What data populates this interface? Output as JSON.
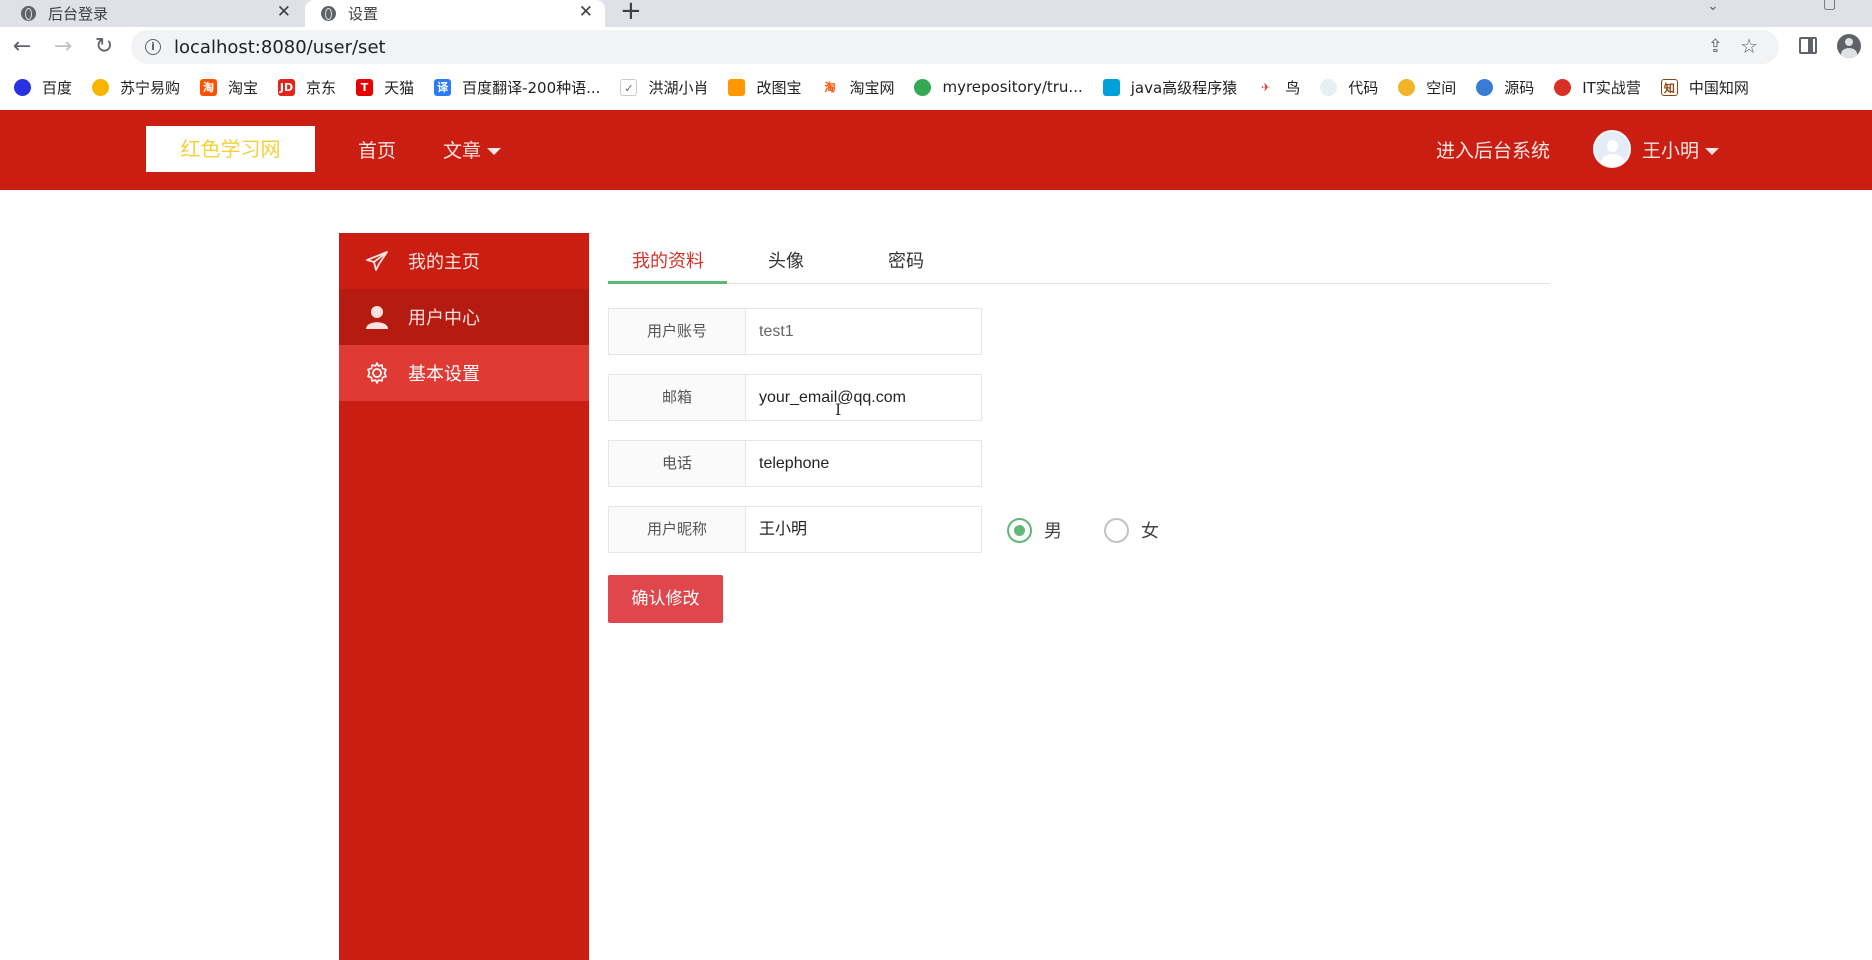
{
  "browser": {
    "tabs": [
      {
        "title": "后台登录",
        "active": false
      },
      {
        "title": "设置",
        "active": true
      }
    ],
    "url": "localhost:8080/user/set",
    "bookmarks": [
      {
        "label": "百度",
        "icon": "baidu-paw-icon",
        "color": "#2932e1"
      },
      {
        "label": "苏宁易购",
        "icon": "suning-lion-icon",
        "color": "#f7b500"
      },
      {
        "label": "淘宝",
        "icon": "taobao-icon",
        "color": "#ff5000"
      },
      {
        "label": "京东",
        "icon": "jd-icon",
        "color": "#e1251b"
      },
      {
        "label": "天猫",
        "icon": "tmall-icon",
        "color": "#e60000"
      },
      {
        "label": "百度翻译-200种语...",
        "icon": "baidu-translate-icon",
        "color": "#2b7cf6"
      },
      {
        "label": "洪湖小肖",
        "icon": "bird-icon",
        "color": "#666666"
      },
      {
        "label": "改图宝",
        "icon": "gaitubao-icon",
        "color": "#ff9800"
      },
      {
        "label": "淘宝网",
        "icon": "taobao-icon",
        "color": "#ff5000"
      },
      {
        "label": "myrepository/tru...",
        "icon": "chrome-icon",
        "color": "#34a853"
      },
      {
        "label": "java高级程序猿",
        "icon": "bilibili-icon",
        "color": "#00a1d6"
      },
      {
        "label": "鸟",
        "icon": "bird-icon",
        "color": "#e53935"
      },
      {
        "label": "代码",
        "icon": "code-icon",
        "color": "#b0c4de"
      },
      {
        "label": "空间",
        "icon": "qzone-icon",
        "color": "#f0b429"
      },
      {
        "label": "源码",
        "icon": "fish-icon",
        "color": "#3a7bd5"
      },
      {
        "label": "IT实战营",
        "icon": "chrome-icon",
        "color": "#d93025"
      },
      {
        "label": "中国知网",
        "icon": "cnki-icon",
        "color": "#8b4513"
      }
    ]
  },
  "header": {
    "logo": "红色学习网",
    "nav_home": "首页",
    "nav_article": "文章",
    "admin_link": "进入后台系统",
    "username": "王小明",
    "brand_color": "#c91e11"
  },
  "sidebar": {
    "items": [
      {
        "label": "我的主页",
        "icon": "paper-plane-icon",
        "active": false
      },
      {
        "label": "用户中心",
        "icon": "user-icon",
        "active": false
      },
      {
        "label": "基本设置",
        "icon": "gear-icon",
        "active": true
      }
    ]
  },
  "content": {
    "tabs": [
      {
        "label": "我的资料",
        "active": true
      },
      {
        "label": "头像",
        "active": false
      },
      {
        "label": "密码",
        "active": false
      }
    ],
    "fields": {
      "account": {
        "label": "用户账号",
        "value": "test1"
      },
      "email": {
        "label": "邮箱",
        "value": "your_email@qq.com"
      },
      "phone": {
        "label": "电话",
        "value": "telephone"
      },
      "nickname": {
        "label": "用户昵称",
        "value": "王小明"
      }
    },
    "gender": {
      "options": [
        "男",
        "女"
      ],
      "selected": "男"
    },
    "submit_label": "确认修改",
    "accent_color": "#5fb878"
  }
}
